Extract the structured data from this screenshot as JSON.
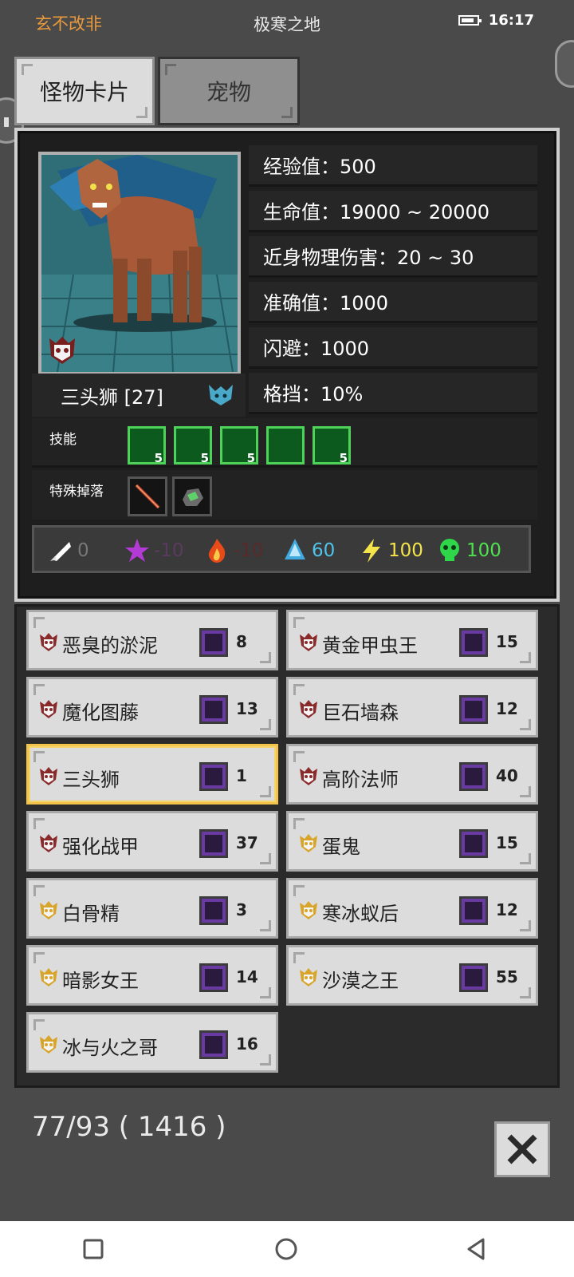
{
  "status_bar": {
    "left_text": "玄不改非",
    "title": "极寒之地",
    "time": "16:17",
    "battery_level": 0.75
  },
  "tabs": [
    {
      "label": "怪物卡片",
      "active": true
    },
    {
      "label": "宠物",
      "active": false
    }
  ],
  "monster": {
    "name": "三头狮 [27]",
    "stats": [
      "经验值：500",
      "生命值：19000 ~ 20000",
      "近身物理伤害：20 ~ 30",
      "准确值：1000",
      "闪避：1000",
      "格挡：10%"
    ],
    "skills_label": "技能",
    "skills": [
      {
        "icon": "skill-roar-icon",
        "level": "5"
      },
      {
        "icon": "skill-slash-icon",
        "level": "5"
      },
      {
        "icon": "skill-swirl-icon",
        "level": "5"
      },
      {
        "icon": "skill-bite-icon",
        "level": ""
      },
      {
        "icon": "skill-claw-icon",
        "level": "5"
      }
    ],
    "drops_label": "特殊掉落",
    "drops": [
      {
        "icon": "rod-drop-icon"
      },
      {
        "icon": "ore-drop-icon"
      }
    ],
    "resistances": [
      {
        "icon": "physical-icon",
        "value": "0",
        "color": "#777777"
      },
      {
        "icon": "arcane-icon",
        "value": "-10",
        "color": "#5a3a5e"
      },
      {
        "icon": "fire-icon",
        "value": "-10",
        "color": "#5a2a2a"
      },
      {
        "icon": "ice-icon",
        "value": "60",
        "color": "#4fc3ea"
      },
      {
        "icon": "lightning-icon",
        "value": "100",
        "color": "#f3e44a"
      },
      {
        "icon": "poison-icon",
        "value": "100",
        "color": "#4ee04e"
      }
    ]
  },
  "monster_list": [
    {
      "name": "恶臭的淤泥",
      "count": "8",
      "tier": "red",
      "selected": false
    },
    {
      "name": "黄金甲虫王",
      "count": "15",
      "tier": "red",
      "selected": false
    },
    {
      "name": "魔化图藤",
      "count": "13",
      "tier": "red",
      "selected": false
    },
    {
      "name": "巨石墙森",
      "count": "12",
      "tier": "red",
      "selected": false
    },
    {
      "name": "三头狮",
      "count": "1",
      "tier": "red",
      "selected": true
    },
    {
      "name": "高阶法师",
      "count": "40",
      "tier": "red",
      "selected": false
    },
    {
      "name": "强化战甲",
      "count": "37",
      "tier": "red",
      "selected": false
    },
    {
      "name": "蛋鬼",
      "count": "15",
      "tier": "gold",
      "selected": false
    },
    {
      "name": "白骨精",
      "count": "3",
      "tier": "gold",
      "selected": false
    },
    {
      "name": "寒冰蚁后",
      "count": "12",
      "tier": "gold",
      "selected": false
    },
    {
      "name": "暗影女王",
      "count": "14",
      "tier": "gold",
      "selected": false
    },
    {
      "name": "沙漠之王",
      "count": "55",
      "tier": "gold",
      "selected": false
    },
    {
      "name": "冰与火之哥",
      "count": "16",
      "tier": "gold",
      "selected": false
    }
  ],
  "footer": {
    "collection": "77/93 ( 1416 )"
  }
}
